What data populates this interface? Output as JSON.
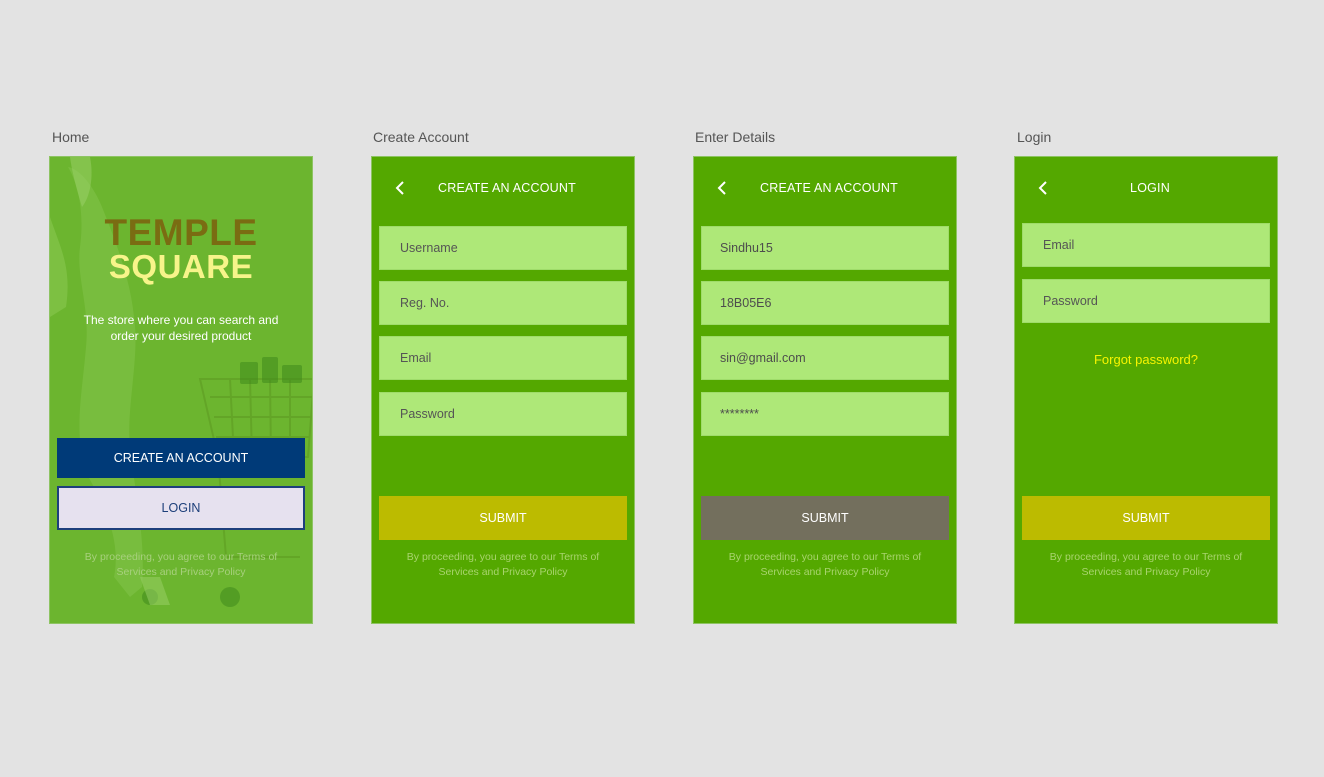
{
  "colors": {
    "canvas": "#e3e3e3",
    "screen_green": "#54a800",
    "field_green": "#aee878",
    "submit_olive": "#bcbb00",
    "submit_disabled": "#736f5d",
    "create_blue": "#003a78",
    "forgot_yellow": "#f7f400"
  },
  "artboards": [
    {
      "label": "Home"
    },
    {
      "label": "Create Account"
    },
    {
      "label": "Enter Details"
    },
    {
      "label": "Login"
    }
  ],
  "home": {
    "brand_line1": "TEMPLE",
    "brand_line2": "SQUARE",
    "tagline": "The store where you can search and order your desired product",
    "create_button": "CREATE AN ACCOUNT",
    "login_button": "LOGIN",
    "legal": "By proceeding, you agree to our Terms of Services and Privacy Policy"
  },
  "create_account": {
    "title": "CREATE AN ACCOUNT",
    "back_icon": "chevron-left-icon",
    "fields": {
      "username": "Username",
      "reg_no": "Reg. No.",
      "email": "Email",
      "password": "Password"
    },
    "submit": "SUBMIT",
    "legal": "By proceeding, you agree to our Terms of Services and Privacy Policy"
  },
  "enter_details": {
    "title": "CREATE AN ACCOUNT",
    "back_icon": "chevron-left-icon",
    "values": {
      "username": "Sindhu15",
      "reg_no": "18B05E6",
      "email": "sin@gmail.com",
      "password": "********"
    },
    "submit": "SUBMIT",
    "legal": "By proceeding, you agree to our Terms of Services and Privacy Policy"
  },
  "login": {
    "title": "LOGIN",
    "back_icon": "chevron-left-icon",
    "fields": {
      "email": "Email",
      "password": "Password"
    },
    "forgot": "Forgot password?",
    "submit": "SUBMIT",
    "legal": "By proceeding, you agree to our Terms of Services and Privacy Policy"
  }
}
